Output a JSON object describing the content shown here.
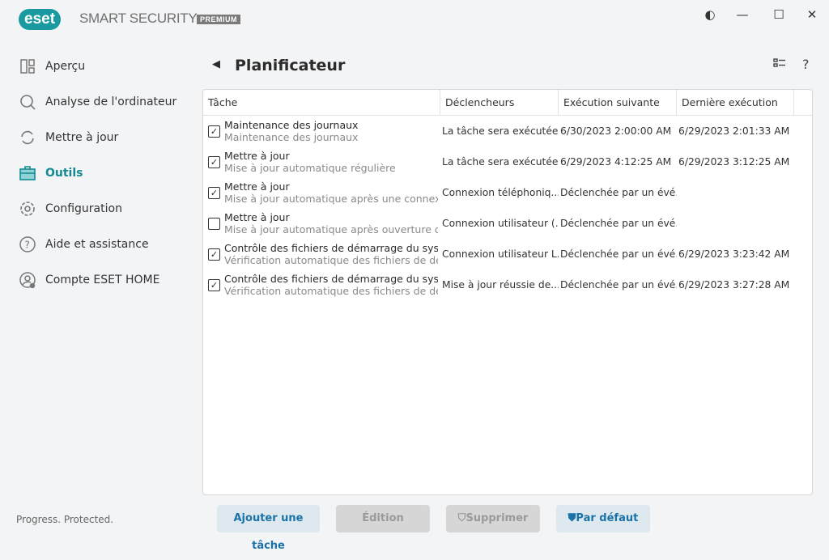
{
  "app": {
    "logo": "eset",
    "product": "SMART SECURITY",
    "edition": "PREMIUM",
    "tagline": "Progress. Protected."
  },
  "window": {
    "theme_icon": "◐",
    "minimize": "—",
    "maximize": "☐",
    "close": "✕"
  },
  "sidebar": {
    "items": [
      {
        "label": "Aperçu",
        "icon": "dashboard-icon"
      },
      {
        "label": "Analyse de l'ordinateur",
        "icon": "search-icon"
      },
      {
        "label": "Mettre à jour",
        "icon": "refresh-icon"
      },
      {
        "label": "Outils",
        "icon": "toolbox-icon",
        "active": true
      },
      {
        "label": "Configuration",
        "icon": "gear-icon"
      },
      {
        "label": "Aide et assistance",
        "icon": "help-icon"
      },
      {
        "label": "Compte ESET HOME",
        "icon": "account-icon"
      }
    ]
  },
  "page": {
    "title": "Planificateur",
    "back": "◀",
    "help": "?"
  },
  "table": {
    "columns": [
      "Tâche",
      "Déclencheurs",
      "Exécution suivante",
      "Dernière exécution"
    ],
    "rows": [
      {
        "checked": true,
        "name": "Maintenance des journaux",
        "desc": "Maintenance des journaux",
        "trigger": "La tâche sera exécutée...",
        "next": "6/30/2023 2:00:00 AM",
        "last": "6/29/2023 2:01:33 AM"
      },
      {
        "checked": true,
        "name": "Mettre à jour",
        "desc": "Mise à jour automatique régulière",
        "trigger": "La tâche sera exécutée...",
        "next": "6/29/2023 4:12:25 AM",
        "last": "6/29/2023 3:12:25 AM"
      },
      {
        "checked": true,
        "name": "Mettre à jour",
        "desc": "Mise à jour automatique après une connexi...",
        "trigger": "Connexion téléphoniq...",
        "next": "Déclenchée par un évé...",
        "last": ""
      },
      {
        "checked": false,
        "name": "Mettre à jour",
        "desc": "Mise à jour automatique après ouverture d...",
        "trigger": "Connexion utilisateur (...",
        "next": "Déclenchée par un évé...",
        "last": ""
      },
      {
        "checked": true,
        "name": "Contrôle des fichiers de démarrage du syst...",
        "desc": "Vérification automatique des fichiers de dé...",
        "trigger": "Connexion utilisateur L...",
        "next": "Déclenchée par un évé...",
        "last": "6/29/2023 3:23:42 AM"
      },
      {
        "checked": true,
        "name": "Contrôle des fichiers de démarrage du syst...",
        "desc": "Vérification automatique des fichiers de dé...",
        "trigger": "Mise à jour réussie de...",
        "next": "Déclenchée par un évé...",
        "last": "6/29/2023 3:27:28 AM"
      }
    ]
  },
  "buttons": {
    "add": "Ajouter une tâche",
    "edit": "Édition",
    "delete": "Supprimer",
    "default": "Par défaut"
  },
  "colors": {
    "accent": "#138a92",
    "button_text": "#1a72a8"
  }
}
